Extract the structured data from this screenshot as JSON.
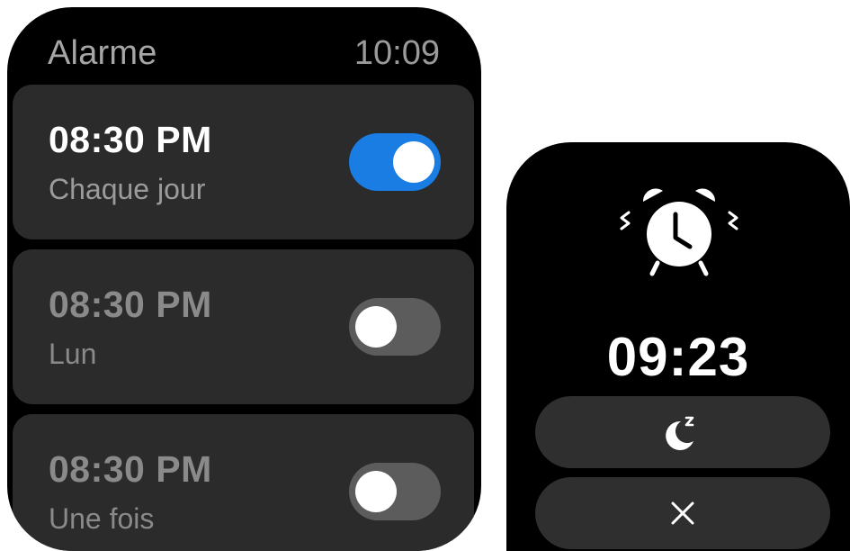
{
  "alarm_list": {
    "title": "Alarme",
    "clock": "10:09",
    "alarms": [
      {
        "time": "08:30 PM",
        "repeat": "Chaque jour",
        "enabled": true
      },
      {
        "time": "08:30 PM",
        "repeat": "Lun",
        "enabled": false
      },
      {
        "time": "08:30 PM",
        "repeat": "Une fois",
        "enabled": false
      }
    ]
  },
  "ringing": {
    "time": "09:23",
    "snooze_icon": "moon-snooze-icon",
    "dismiss_icon": "close-icon"
  },
  "colors": {
    "accent": "#1a7de3",
    "card": "#2b2b2b",
    "toggle_off": "#5c5c5c"
  }
}
